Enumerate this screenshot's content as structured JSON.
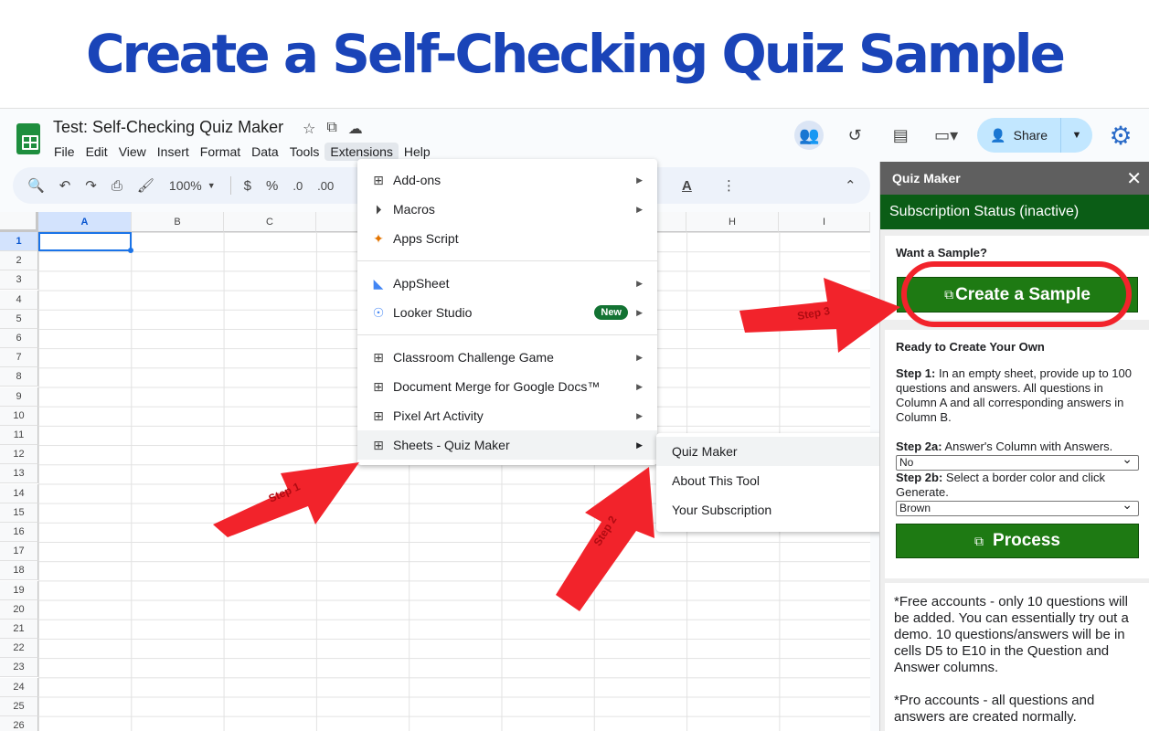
{
  "banner": {
    "title": "Create a Self-Checking Quiz Sample"
  },
  "app": {
    "doc_title": "Test: Self-Checking Quiz Maker",
    "menu": [
      "File",
      "Edit",
      "View",
      "Insert",
      "Format",
      "Data",
      "Tools",
      "Extensions",
      "Help"
    ],
    "share_label": "Share",
    "zoom": "100%",
    "toolbar_symbols": [
      "$",
      "%",
      ".0",
      ".00"
    ],
    "icons": [
      "star-icon",
      "move-to-drive-icon",
      "cloud-status-icon",
      "history-icon",
      "comment-icon",
      "video-call-icon",
      "people-icon",
      "settings-gear-icon"
    ]
  },
  "grid": {
    "columns": [
      "A",
      "B",
      "C",
      "",
      "",
      "",
      "",
      "H",
      "I"
    ],
    "rows": [
      "1",
      "2",
      "3",
      "4",
      "5",
      "6",
      "7",
      "8",
      "9",
      "10",
      "11",
      "12",
      "13",
      "14",
      "15",
      "16",
      "17",
      "18",
      "19",
      "20",
      "21",
      "22",
      "23",
      "24",
      "25",
      "26"
    ],
    "active_cell": "A1"
  },
  "extensions_menu": {
    "items": [
      {
        "label": "Add-ons",
        "icon": "addon-icon",
        "submenu": true
      },
      {
        "label": "Macros",
        "icon": "play-circle-icon",
        "submenu": true
      },
      {
        "label": "Apps Script",
        "icon": "apps-script-icon",
        "submenu": false
      },
      {
        "label": "AppSheet",
        "icon": "appsheet-icon",
        "submenu": true
      },
      {
        "label": "Looker Studio",
        "icon": "looker-icon",
        "submenu": true,
        "badge": "New"
      },
      {
        "label": "Classroom Challenge Game",
        "icon": "addon-icon",
        "submenu": true
      },
      {
        "label": "Document Merge for Google Docs™",
        "icon": "addon-icon",
        "submenu": true
      },
      {
        "label": "Pixel Art Activity",
        "icon": "addon-icon",
        "submenu": true
      },
      {
        "label": "Sheets - Quiz Maker",
        "icon": "addon-icon",
        "submenu": true
      }
    ]
  },
  "quiz_submenu": {
    "items": [
      "Quiz Maker",
      "About This Tool",
      "Your Subscription"
    ]
  },
  "sidebar": {
    "title": "Quiz Maker",
    "status": "Subscription Status (inactive)",
    "sample_card": {
      "title": "Want a Sample?",
      "button": "Create a Sample"
    },
    "own_card": {
      "title": "Ready to Create Your Own",
      "step1_label": "Step 1:",
      "step1_text": " In an empty sheet, provide up to 100 questions and answers. All questions in Column A and all corresponding answers in Column B.",
      "step2a_label": "Step 2a:",
      "step2a_text": " Answer's Column with Answers.",
      "step2a_value": "No",
      "step2b_label": "Step 2b:",
      "step2b_text": " Select a border color and click Generate.",
      "step2b_value": "Brown",
      "process_button": "Process"
    },
    "info_card": {
      "free_text": "*Free accounts - only 10 questions will be added. You can essentially try out a demo. 10 questions/answers will be in cells D5 to E10 in the Question and Answer columns.",
      "pro_text": "*Pro accounts - all questions and answers are created normally."
    }
  },
  "annotations": {
    "step1": "Step 1",
    "step2": "Step 2",
    "step3": "Step 3",
    "color": "#f2232b"
  }
}
